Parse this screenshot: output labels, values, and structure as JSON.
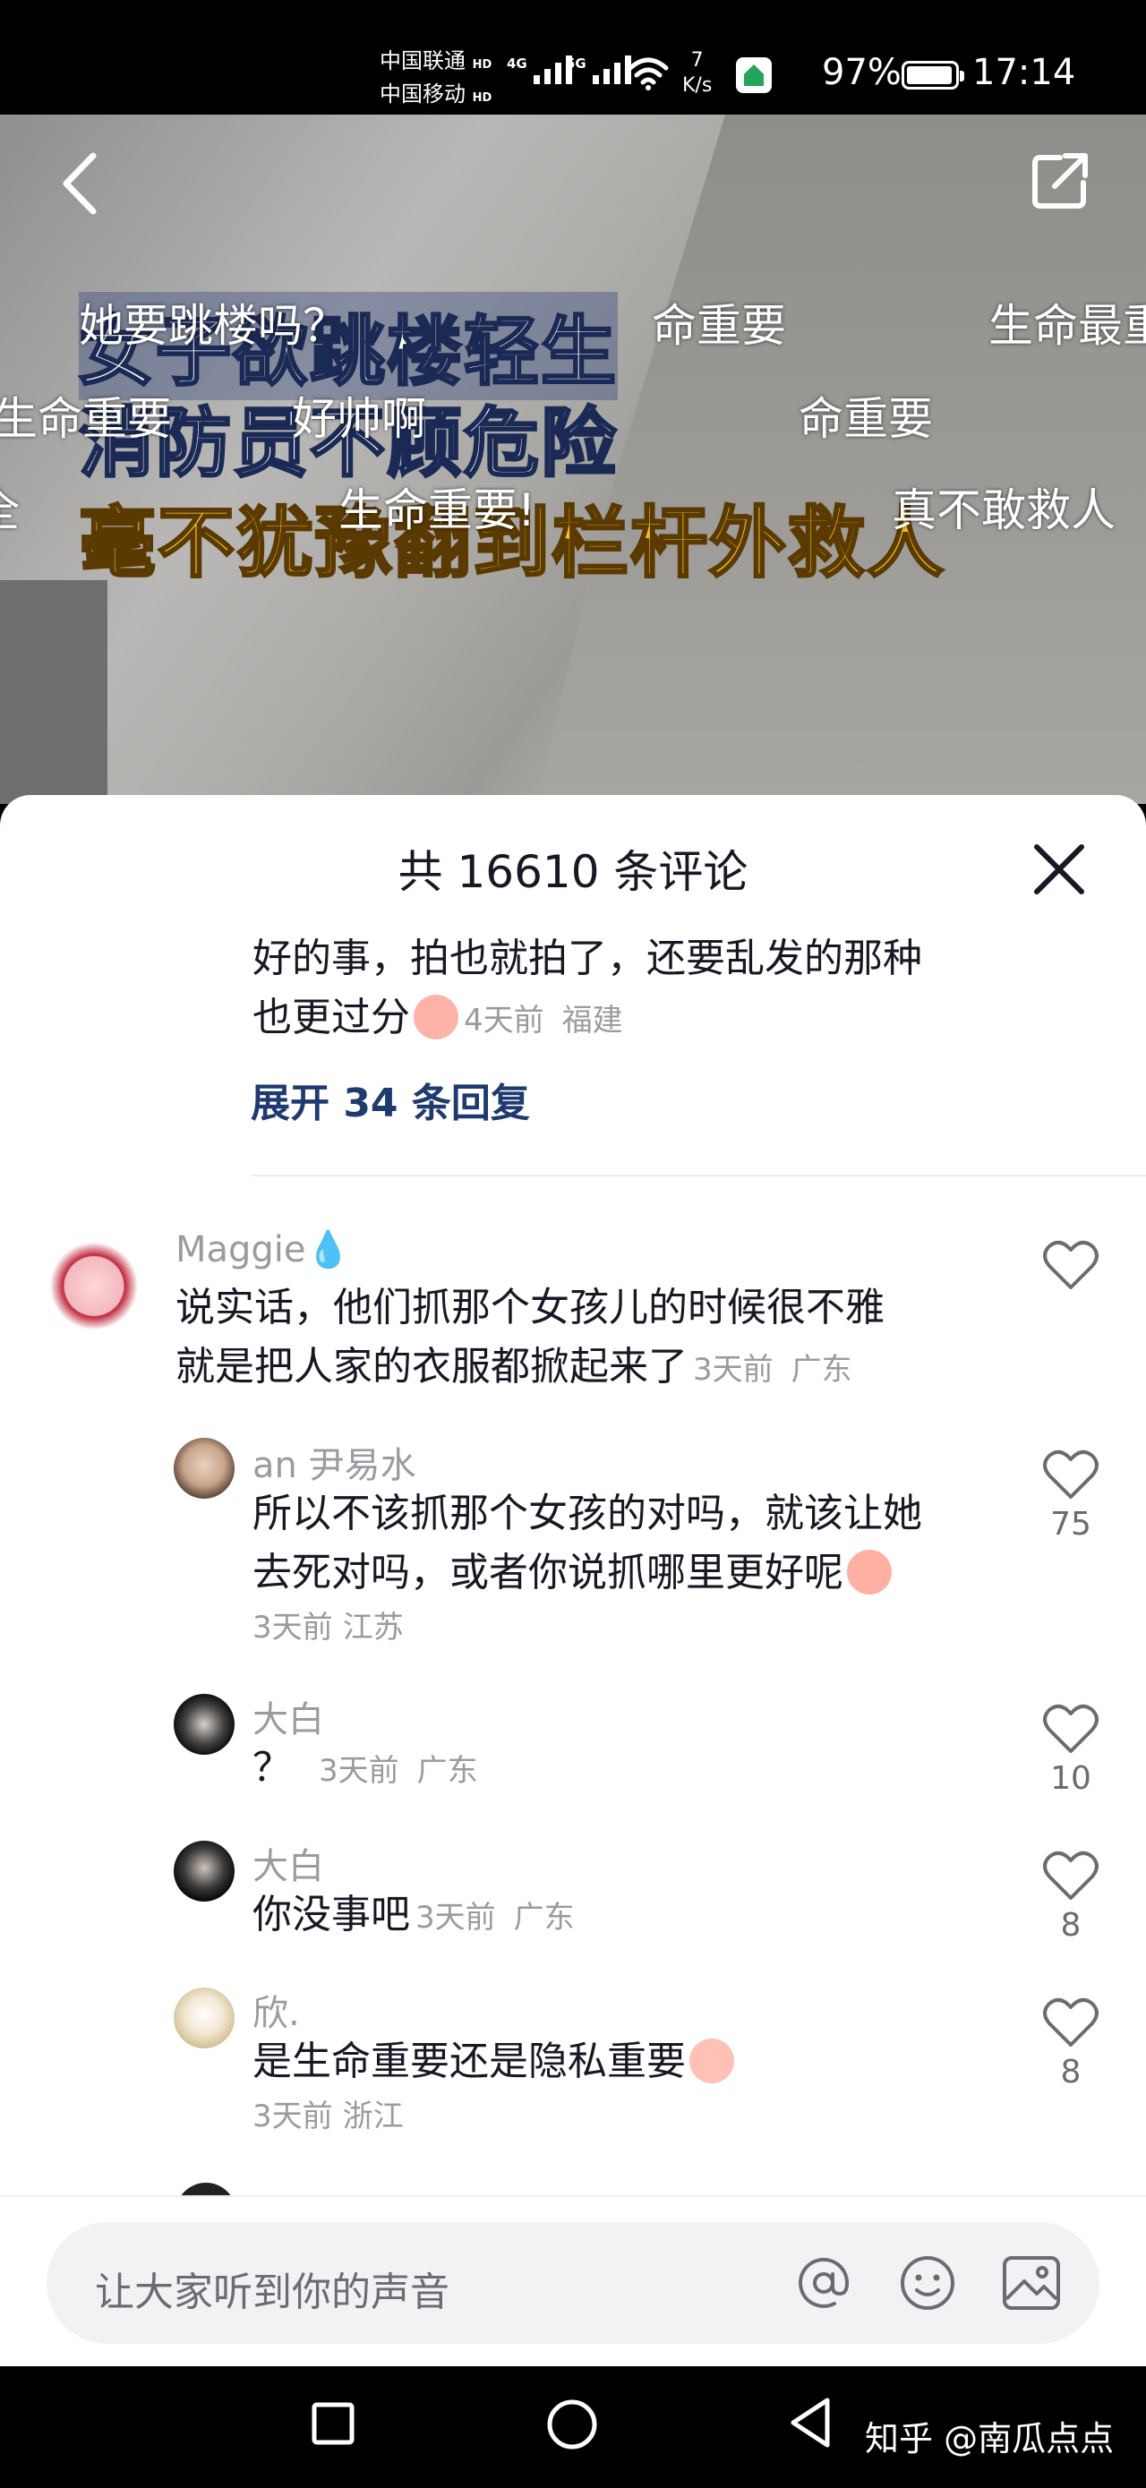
{
  "status_bar": {
    "carrier1": "中国联通",
    "carrier2": "中国移动",
    "hd": "HD",
    "net1": "4G",
    "net2": "5G",
    "speed_value": "7",
    "speed_unit": "K/s",
    "battery": "97%",
    "battery_level": 0.97,
    "time": "17:14"
  },
  "video": {
    "caption_line1": "女子欲跳楼轻生",
    "caption_line2": "消防员不顾危险",
    "caption_line3": "毫不犹豫翻到栏杆外救人",
    "danmaku": [
      "她要跳楼吗？",
      "命重要",
      "生命最重",
      "生命重要",
      "好帅啊",
      "命重要",
      "全",
      "生命重要!",
      "真不敢救人"
    ]
  },
  "comments_panel": {
    "title": "共 16610 条评论",
    "previous_tail": {
      "line1": "好的事，拍也就拍了，还要乱发的那种",
      "line2": "也更过分",
      "time": "4天前",
      "location": "福建"
    },
    "expand_replies": "展开 34 条回复",
    "main_comment": {
      "username": "Maggie💧",
      "line1": "说实话，他们抓那个女孩儿的时候很不雅",
      "line2": "就是把人家的衣服都掀起来了",
      "time": "3天前",
      "location": "广东"
    },
    "replies": [
      {
        "username": "an 尹易水",
        "line1": "所以不该抓那个女孩的对吗，就该让她",
        "line2": "去死对吗，或者你说抓哪里更好呢",
        "time": "3天前",
        "location": "江苏",
        "likes": "75"
      },
      {
        "username": "大白",
        "line1": "？",
        "time": "3天前",
        "location": "广东",
        "likes": "10"
      },
      {
        "username": "大白",
        "line1": "你没事吧",
        "time": "3天前",
        "location": "广东",
        "likes": "8"
      },
      {
        "username": "欣.",
        "line1": "是生命重要还是隐私重要",
        "time": "3天前",
        "location": "浙江",
        "likes": "8"
      }
    ]
  },
  "input_bar": {
    "placeholder": "让大家听到你的声音"
  },
  "nav_bar": {
    "watermark": "知乎 @南瓜点点"
  }
}
